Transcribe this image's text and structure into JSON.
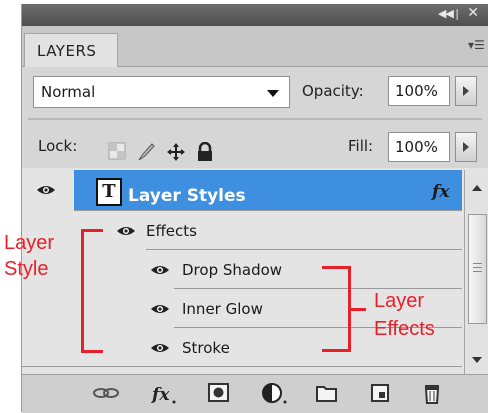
{
  "panel": {
    "tab_label": "LAYERS",
    "blend_mode": "Normal",
    "opacity_label": "Opacity:",
    "opacity_value": "100%",
    "lock_label": "Lock:",
    "fill_label": "Fill:",
    "fill_value": "100%"
  },
  "layer": {
    "name": "Layer Styles",
    "thumb_letter": "T",
    "fx_badge": "fx"
  },
  "effects": {
    "group_label": "Effects",
    "items": [
      "Drop Shadow",
      "Inner Glow",
      "Stroke"
    ]
  },
  "annotations": {
    "layer_style_line1": "Layer",
    "layer_style_line2": "Style",
    "layer_effects_line1": "Layer",
    "layer_effects_line2": "Effects"
  },
  "colors": {
    "selection": "#3f8fe0",
    "annotation": "#e8202a",
    "panel_bg": "#d6d6d6"
  },
  "bottom_icons": [
    "link-layers-icon",
    "fx-icon",
    "add-mask-icon",
    "adjustment-layer-icon",
    "new-group-icon",
    "new-layer-icon",
    "trash-icon"
  ]
}
